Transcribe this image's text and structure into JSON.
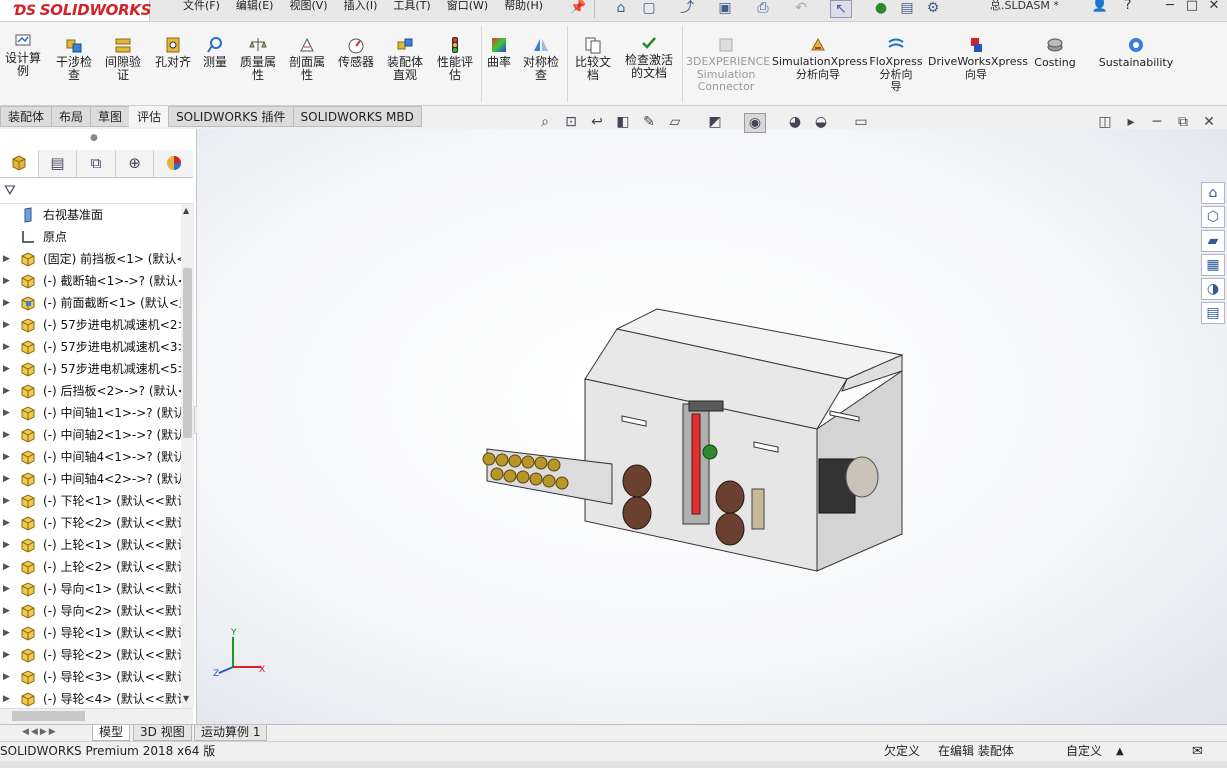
{
  "app": {
    "brand": "SOLIDWORKS",
    "filename": "总.SLDASM *"
  },
  "menu": [
    "文件(F)",
    "编辑(E)",
    "视图(V)",
    "插入(I)",
    "工具(T)",
    "窗口(W)",
    "帮助(H)"
  ],
  "commands": [
    {
      "label": "设计算\n例",
      "icon": "design-study-icon"
    },
    {
      "label": "干涉检\n查",
      "icon": "interference-icon"
    },
    {
      "label": "间隙验\n证",
      "icon": "clearance-icon"
    },
    {
      "label": "孔对齐",
      "icon": "hole-align-icon"
    },
    {
      "label": "测量",
      "icon": "measure-icon"
    },
    {
      "label": "质量属\n性",
      "icon": "mass-properties-icon"
    },
    {
      "label": "剖面属\n性",
      "icon": "section-properties-icon"
    },
    {
      "label": "传感器",
      "icon": "sensor-icon"
    },
    {
      "label": "装配体\n直观",
      "icon": "assembly-visualization-icon"
    },
    {
      "label": "性能评\n估",
      "icon": "performance-icon"
    },
    {
      "label": "曲率",
      "icon": "curvature-icon"
    },
    {
      "label": "对称检\n查",
      "icon": "symmetry-icon"
    },
    {
      "label": "比较文\n档",
      "icon": "compare-icon"
    },
    {
      "label": "检查激活\n的文档",
      "icon": "check-document-icon"
    },
    {
      "label": "3DEXPERIENCE\nSimulation\nConnector",
      "icon": "3dx-icon",
      "disabled": true
    },
    {
      "label": "SimulationXpress\n分析向导",
      "icon": "simulationxpress-icon"
    },
    {
      "label": "FloXpress\n分析向\n导",
      "icon": "floxpress-icon"
    },
    {
      "label": "DriveWorksXpress\n向导",
      "icon": "driveworks-icon"
    },
    {
      "label": "Costing",
      "icon": "costing-icon"
    },
    {
      "label": "Sustainability",
      "icon": "sustainability-icon"
    }
  ],
  "tabs": [
    "装配体",
    "布局",
    "草图",
    "评估",
    "SOLIDWORKS 插件",
    "SOLIDWORKS MBD"
  ],
  "active_tab": "评估",
  "tree": [
    {
      "label": "右视基准面",
      "icon": "plane-icon",
      "expandable": false
    },
    {
      "label": "原点",
      "icon": "origin-icon",
      "expandable": false
    },
    {
      "label": "(固定) 前挡板<1> (默认<",
      "icon": "part-icon",
      "expandable": true
    },
    {
      "label": "(-) 截断轴<1>->? (默认<",
      "icon": "part-icon",
      "expandable": true
    },
    {
      "label": "(-) 前面截断<1> (默认<显",
      "icon": "subassembly-icon",
      "expandable": true
    },
    {
      "label": "(-) 57步进电机减速机<2>",
      "icon": "part-icon",
      "expandable": true
    },
    {
      "label": "(-) 57步进电机减速机<3>",
      "icon": "part-icon",
      "expandable": true
    },
    {
      "label": "(-) 57步进电机减速机<5>",
      "icon": "part-icon",
      "expandable": true
    },
    {
      "label": "(-) 后挡板<2>->? (默认<",
      "icon": "part-icon",
      "expandable": true
    },
    {
      "label": "(-) 中间轴1<1>->? (默认",
      "icon": "part-icon",
      "expandable": true
    },
    {
      "label": "(-) 中间轴2<1>->? (默认",
      "icon": "part-icon",
      "expandable": true
    },
    {
      "label": "(-) 中间轴4<1>->? (默认",
      "icon": "part-icon",
      "expandable": true
    },
    {
      "label": "(-) 中间轴4<2>->? (默认",
      "icon": "part-icon",
      "expandable": true
    },
    {
      "label": "(-) 下轮<1> (默认<<默认",
      "icon": "part-icon",
      "expandable": true
    },
    {
      "label": "(-) 下轮<2> (默认<<默认",
      "icon": "part-icon",
      "expandable": true
    },
    {
      "label": "(-) 上轮<1> (默认<<默认",
      "icon": "part-icon",
      "expandable": true
    },
    {
      "label": "(-) 上轮<2> (默认<<默认",
      "icon": "part-icon",
      "expandable": true
    },
    {
      "label": "(-) 导向<1> (默认<<默认",
      "icon": "part-icon",
      "expandable": true
    },
    {
      "label": "(-) 导向<2> (默认<<默认",
      "icon": "part-icon",
      "expandable": true
    },
    {
      "label": "(-) 导轮<1> (默认<<默认",
      "icon": "part-icon",
      "expandable": true
    },
    {
      "label": "(-) 导轮<2> (默认<<默认",
      "icon": "part-icon",
      "expandable": true
    },
    {
      "label": "(-) 导轮<3> (默认<<默认",
      "icon": "part-icon",
      "expandable": true
    },
    {
      "label": "(-) 导轮<4> (默认<<默认",
      "icon": "part-icon",
      "expandable": true
    }
  ],
  "bottom_tabs": [
    "模型",
    "3D 视图",
    "运动算例 1"
  ],
  "status": {
    "version": "SOLIDWORKS Premium 2018 x64 版",
    "defined": "欠定义",
    "editing": "在编辑 装配体",
    "custom": "自定义"
  },
  "axes": {
    "x": "X",
    "y": "Y",
    "z": "Z"
  }
}
